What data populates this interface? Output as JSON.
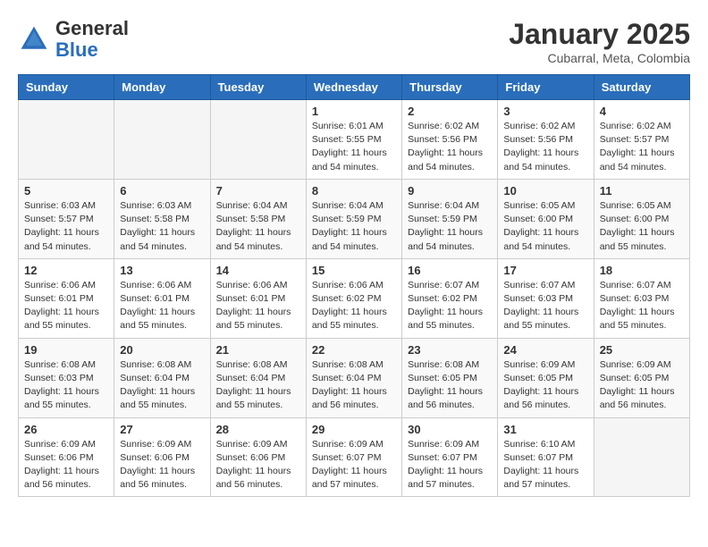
{
  "header": {
    "logo_general": "General",
    "logo_blue": "Blue",
    "month_title": "January 2025",
    "subtitle": "Cubarral, Meta, Colombia"
  },
  "weekdays": [
    "Sunday",
    "Monday",
    "Tuesday",
    "Wednesday",
    "Thursday",
    "Friday",
    "Saturday"
  ],
  "weeks": [
    [
      {
        "day": "",
        "sunrise": "",
        "sunset": "",
        "daylight": ""
      },
      {
        "day": "",
        "sunrise": "",
        "sunset": "",
        "daylight": ""
      },
      {
        "day": "",
        "sunrise": "",
        "sunset": "",
        "daylight": ""
      },
      {
        "day": "1",
        "sunrise": "Sunrise: 6:01 AM",
        "sunset": "Sunset: 5:55 PM",
        "daylight": "Daylight: 11 hours and 54 minutes."
      },
      {
        "day": "2",
        "sunrise": "Sunrise: 6:02 AM",
        "sunset": "Sunset: 5:56 PM",
        "daylight": "Daylight: 11 hours and 54 minutes."
      },
      {
        "day": "3",
        "sunrise": "Sunrise: 6:02 AM",
        "sunset": "Sunset: 5:56 PM",
        "daylight": "Daylight: 11 hours and 54 minutes."
      },
      {
        "day": "4",
        "sunrise": "Sunrise: 6:02 AM",
        "sunset": "Sunset: 5:57 PM",
        "daylight": "Daylight: 11 hours and 54 minutes."
      }
    ],
    [
      {
        "day": "5",
        "sunrise": "Sunrise: 6:03 AM",
        "sunset": "Sunset: 5:57 PM",
        "daylight": "Daylight: 11 hours and 54 minutes."
      },
      {
        "day": "6",
        "sunrise": "Sunrise: 6:03 AM",
        "sunset": "Sunset: 5:58 PM",
        "daylight": "Daylight: 11 hours and 54 minutes."
      },
      {
        "day": "7",
        "sunrise": "Sunrise: 6:04 AM",
        "sunset": "Sunset: 5:58 PM",
        "daylight": "Daylight: 11 hours and 54 minutes."
      },
      {
        "day": "8",
        "sunrise": "Sunrise: 6:04 AM",
        "sunset": "Sunset: 5:59 PM",
        "daylight": "Daylight: 11 hours and 54 minutes."
      },
      {
        "day": "9",
        "sunrise": "Sunrise: 6:04 AM",
        "sunset": "Sunset: 5:59 PM",
        "daylight": "Daylight: 11 hours and 54 minutes."
      },
      {
        "day": "10",
        "sunrise": "Sunrise: 6:05 AM",
        "sunset": "Sunset: 6:00 PM",
        "daylight": "Daylight: 11 hours and 54 minutes."
      },
      {
        "day": "11",
        "sunrise": "Sunrise: 6:05 AM",
        "sunset": "Sunset: 6:00 PM",
        "daylight": "Daylight: 11 hours and 55 minutes."
      }
    ],
    [
      {
        "day": "12",
        "sunrise": "Sunrise: 6:06 AM",
        "sunset": "Sunset: 6:01 PM",
        "daylight": "Daylight: 11 hours and 55 minutes."
      },
      {
        "day": "13",
        "sunrise": "Sunrise: 6:06 AM",
        "sunset": "Sunset: 6:01 PM",
        "daylight": "Daylight: 11 hours and 55 minutes."
      },
      {
        "day": "14",
        "sunrise": "Sunrise: 6:06 AM",
        "sunset": "Sunset: 6:01 PM",
        "daylight": "Daylight: 11 hours and 55 minutes."
      },
      {
        "day": "15",
        "sunrise": "Sunrise: 6:06 AM",
        "sunset": "Sunset: 6:02 PM",
        "daylight": "Daylight: 11 hours and 55 minutes."
      },
      {
        "day": "16",
        "sunrise": "Sunrise: 6:07 AM",
        "sunset": "Sunset: 6:02 PM",
        "daylight": "Daylight: 11 hours and 55 minutes."
      },
      {
        "day": "17",
        "sunrise": "Sunrise: 6:07 AM",
        "sunset": "Sunset: 6:03 PM",
        "daylight": "Daylight: 11 hours and 55 minutes."
      },
      {
        "day": "18",
        "sunrise": "Sunrise: 6:07 AM",
        "sunset": "Sunset: 6:03 PM",
        "daylight": "Daylight: 11 hours and 55 minutes."
      }
    ],
    [
      {
        "day": "19",
        "sunrise": "Sunrise: 6:08 AM",
        "sunset": "Sunset: 6:03 PM",
        "daylight": "Daylight: 11 hours and 55 minutes."
      },
      {
        "day": "20",
        "sunrise": "Sunrise: 6:08 AM",
        "sunset": "Sunset: 6:04 PM",
        "daylight": "Daylight: 11 hours and 55 minutes."
      },
      {
        "day": "21",
        "sunrise": "Sunrise: 6:08 AM",
        "sunset": "Sunset: 6:04 PM",
        "daylight": "Daylight: 11 hours and 55 minutes."
      },
      {
        "day": "22",
        "sunrise": "Sunrise: 6:08 AM",
        "sunset": "Sunset: 6:04 PM",
        "daylight": "Daylight: 11 hours and 56 minutes."
      },
      {
        "day": "23",
        "sunrise": "Sunrise: 6:08 AM",
        "sunset": "Sunset: 6:05 PM",
        "daylight": "Daylight: 11 hours and 56 minutes."
      },
      {
        "day": "24",
        "sunrise": "Sunrise: 6:09 AM",
        "sunset": "Sunset: 6:05 PM",
        "daylight": "Daylight: 11 hours and 56 minutes."
      },
      {
        "day": "25",
        "sunrise": "Sunrise: 6:09 AM",
        "sunset": "Sunset: 6:05 PM",
        "daylight": "Daylight: 11 hours and 56 minutes."
      }
    ],
    [
      {
        "day": "26",
        "sunrise": "Sunrise: 6:09 AM",
        "sunset": "Sunset: 6:06 PM",
        "daylight": "Daylight: 11 hours and 56 minutes."
      },
      {
        "day": "27",
        "sunrise": "Sunrise: 6:09 AM",
        "sunset": "Sunset: 6:06 PM",
        "daylight": "Daylight: 11 hours and 56 minutes."
      },
      {
        "day": "28",
        "sunrise": "Sunrise: 6:09 AM",
        "sunset": "Sunset: 6:06 PM",
        "daylight": "Daylight: 11 hours and 56 minutes."
      },
      {
        "day": "29",
        "sunrise": "Sunrise: 6:09 AM",
        "sunset": "Sunset: 6:07 PM",
        "daylight": "Daylight: 11 hours and 57 minutes."
      },
      {
        "day": "30",
        "sunrise": "Sunrise: 6:09 AM",
        "sunset": "Sunset: 6:07 PM",
        "daylight": "Daylight: 11 hours and 57 minutes."
      },
      {
        "day": "31",
        "sunrise": "Sunrise: 6:10 AM",
        "sunset": "Sunset: 6:07 PM",
        "daylight": "Daylight: 11 hours and 57 minutes."
      },
      {
        "day": "",
        "sunrise": "",
        "sunset": "",
        "daylight": ""
      }
    ]
  ]
}
